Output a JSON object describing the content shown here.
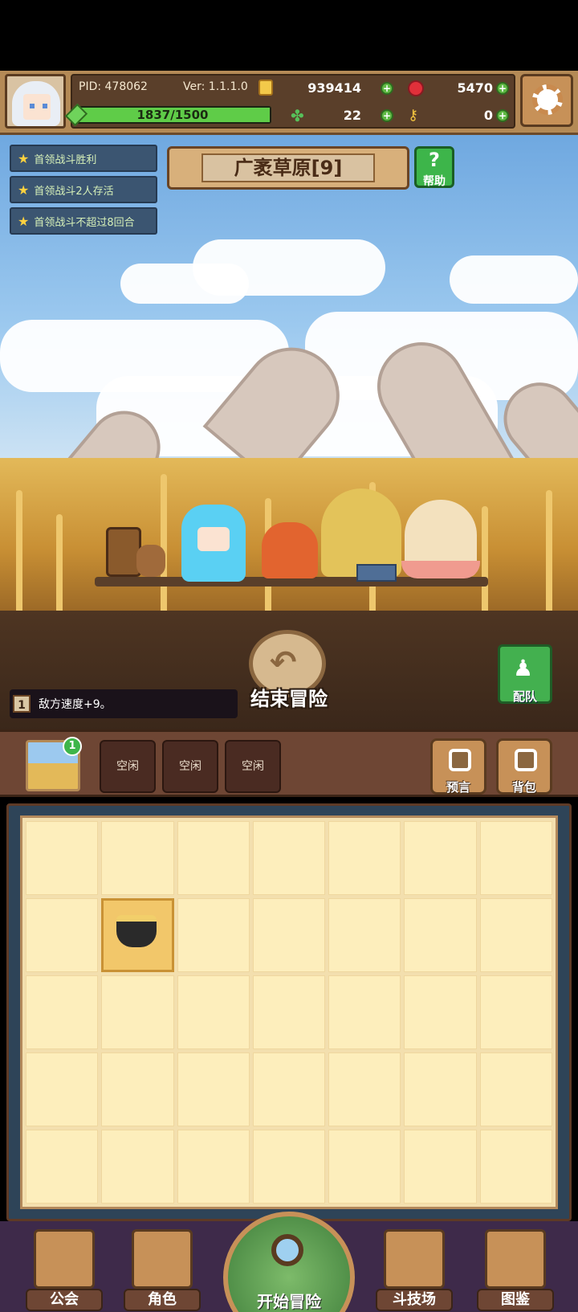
{
  "header": {
    "pid": "PID: 478062",
    "version": "Ver: 1.1.1.0",
    "gold": "939414",
    "gems": "5470",
    "exp_label": "1837/1500",
    "exp_fill": 1.0,
    "clover": "22",
    "keys": "0"
  },
  "quests": [
    {
      "label": "首领战斗胜利"
    },
    {
      "label": "首领战斗2人存活"
    },
    {
      "label": "首领战斗不超过8回合"
    }
  ],
  "stage": {
    "title": "广袤草原[9]",
    "help_label": "帮助"
  },
  "battle": {
    "end_label": "结束冒险",
    "team_label": "配队",
    "modifier_num": "1",
    "modifier_text": "敌方速度+9。"
  },
  "slots": {
    "map_badge": "1",
    "idle": [
      "空闲",
      "空闲",
      "空闲"
    ],
    "prophecy_label": "预言",
    "bag_label": "背包"
  },
  "inventory": {
    "rows": 5,
    "cols": 7,
    "item_index": 8,
    "item_icon": "cauldron-icon"
  },
  "nav": {
    "guild": "公会",
    "role": "角色",
    "start": "开始冒险",
    "arena": "斗技场",
    "codex": "图鉴"
  },
  "colors": {
    "accent_green": "#5fb944",
    "frame_brown": "#c79158",
    "sky": "#9cc9ef"
  }
}
